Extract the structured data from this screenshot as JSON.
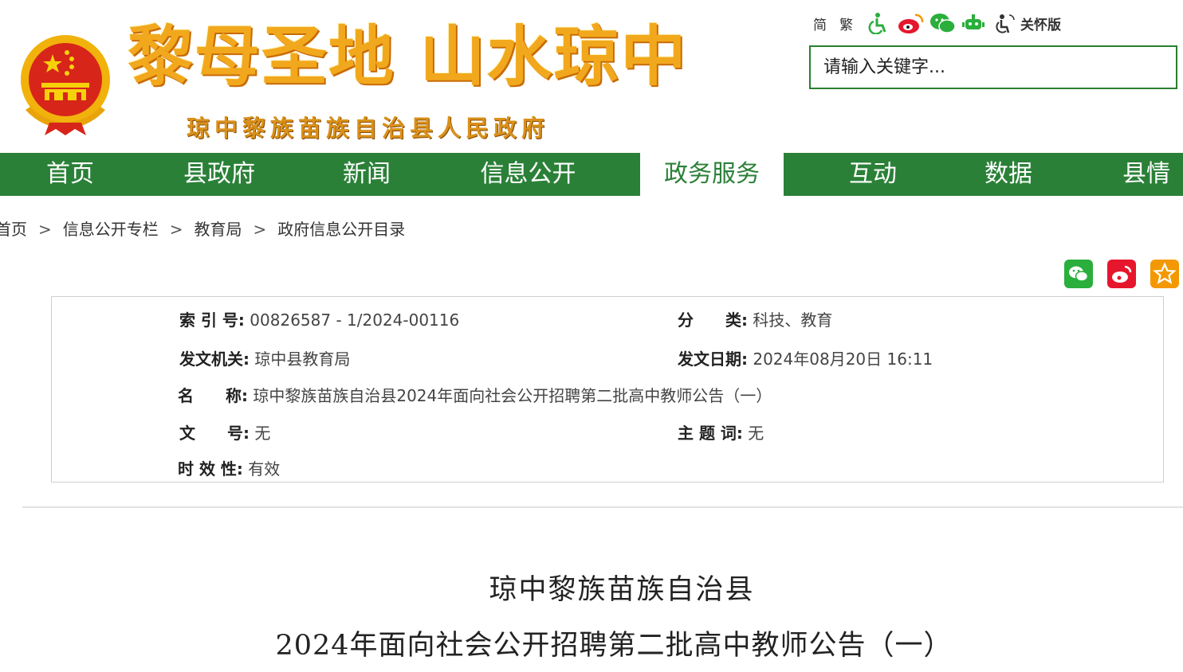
{
  "header": {
    "slogan": "黎母圣地 山水琼中",
    "site_name": "琼中黎族苗族自治县人民政府",
    "toolbar": {
      "simplified": "简",
      "traditional": "繁",
      "care_mode": "关怀版"
    },
    "search": {
      "placeholder": "请输入关键字..."
    }
  },
  "nav": {
    "items": [
      {
        "label": "首页"
      },
      {
        "label": "县政府"
      },
      {
        "label": "新闻"
      },
      {
        "label": "信息公开"
      },
      {
        "label": "政务服务"
      },
      {
        "label": "互动"
      },
      {
        "label": "数据"
      },
      {
        "label": "县情"
      }
    ],
    "active": "政务服务"
  },
  "breadcrumb": [
    "首页",
    "信息公开专栏",
    "教育局",
    "政府信息公开目录"
  ],
  "info": {
    "index_no": {
      "label": "索 引 号:",
      "value": "00826587 - 1/2024-00116"
    },
    "category": {
      "label": "分　　类:",
      "value": "科技、教育"
    },
    "issuer": {
      "label": "发文机关:",
      "value": "琼中县教育局"
    },
    "date": {
      "label": "发文日期:",
      "value": "2024年08月20日 16:11"
    },
    "name": {
      "label": "名　　称:",
      "value": "琼中黎族苗族自治县2024年面向社会公开招聘第二批高中教师公告（一）"
    },
    "doc_no": {
      "label": "文　　号:",
      "value": "无"
    },
    "keywords": {
      "label": "主 题 词:",
      "value": "无"
    },
    "validity": {
      "label": "时 效 性:",
      "value": "有效"
    }
  },
  "article": {
    "title_line1": "琼中黎族苗族自治县",
    "title_line2": "2024年面向社会公开招聘第二批高中教师公告（一）"
  },
  "colors": {
    "nav_green": "#2b8038",
    "slogan_gold": "#f2a81d",
    "wechat_green": "#2aae3c",
    "weibo_red": "#e6162d",
    "favorite_orange": "#f39800"
  }
}
